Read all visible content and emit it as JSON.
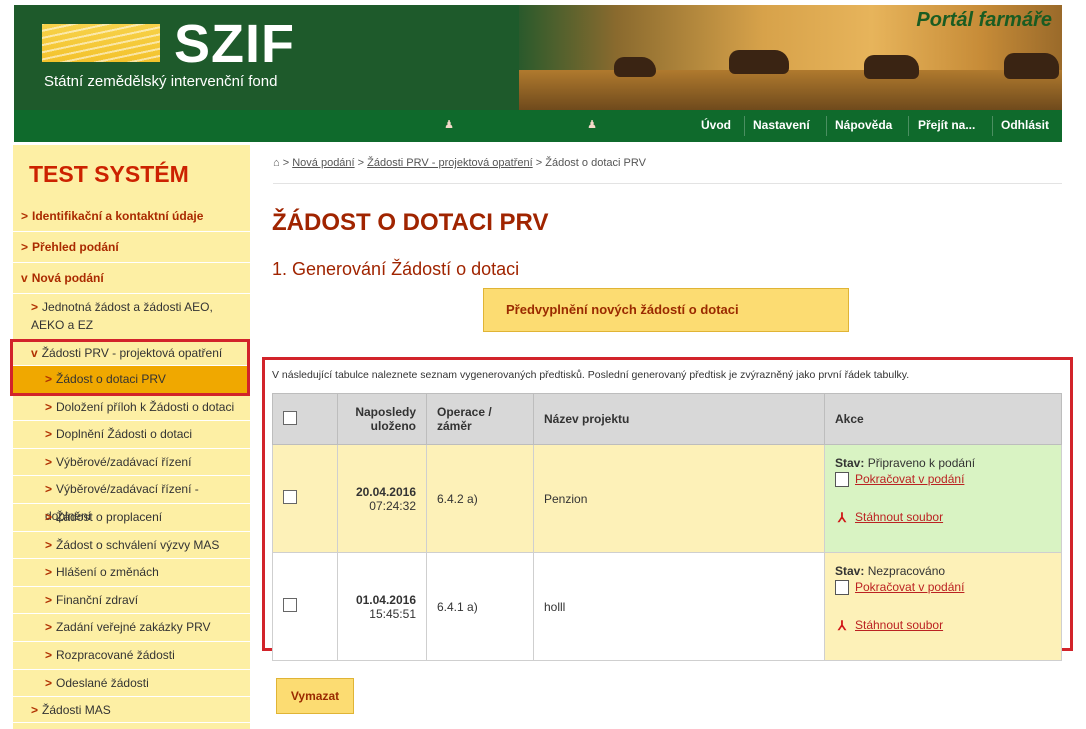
{
  "header": {
    "brand": "SZIF",
    "brand_subtitle": "Státní zemědělský intervenční fond",
    "portal_title": "Portál farmáře",
    "nav": [
      "Úvod",
      "Nastavení",
      "Nápověda",
      "Přejít na...",
      "Odhlásit"
    ]
  },
  "sidebar": {
    "system_title": "TEST SYSTÉM",
    "items": [
      {
        "label": "Identifikační a kontaktní údaje",
        "arrow": ">"
      },
      {
        "label": "Přehled podání",
        "arrow": ">"
      },
      {
        "label": "Nová podání",
        "arrow": "v"
      },
      {
        "label": "Jednotná žádost a žádosti AEO, AEKO a EZ",
        "arrow": ">"
      },
      {
        "label": "Žádosti PRV - projektová opatření",
        "arrow": "v"
      },
      {
        "label": "Žádost o dotaci PRV",
        "arrow": ">"
      },
      {
        "label": "Doložení příloh k Žádosti o dotaci",
        "arrow": ">"
      },
      {
        "label": "Doplnění Žádosti o dotaci",
        "arrow": ">"
      },
      {
        "label": "Výběrové/zadávací řízení",
        "arrow": ">"
      },
      {
        "label": "Výběrové/zadávací řízení - doplnění",
        "arrow": ">"
      },
      {
        "label": "Žádost o proplacení",
        "arrow": ">"
      },
      {
        "label": "Žádost o schválení výzvy MAS",
        "arrow": ">"
      },
      {
        "label": "Hlášení o změnách",
        "arrow": ">"
      },
      {
        "label": "Finanční zdraví",
        "arrow": ">"
      },
      {
        "label": "Zadání veřejné zakázky PRV",
        "arrow": ">"
      },
      {
        "label": "Rozpracované žádosti",
        "arrow": ">"
      },
      {
        "label": "Odeslané žádosti",
        "arrow": ">"
      },
      {
        "label": "Žádosti MAS",
        "arrow": ">"
      }
    ]
  },
  "breadcrumb": {
    "items": [
      "Nová podání",
      "Žádosti PRV - projektová opatření"
    ],
    "current": "Žádost o dotaci PRV",
    "separator": ">"
  },
  "main": {
    "title": "ŽÁDOST O DOTACI PRV",
    "subtitle": "1. Generování Žádostí o dotaci",
    "prefill_button": "Předvyplnění nových žádostí o dotaci",
    "info_text": "V následující tabulce naleznete seznam vygenerovaných předtisků. Poslední generovaný předtisk je zvýrazněný jako první řádek tabulky.",
    "delete_button": "Vymazat"
  },
  "table": {
    "headers": [
      "Naposledy uloženo",
      "Operace / záměr",
      "Název projektu",
      "Akce"
    ],
    "status_label": "Stav:",
    "continue_link": "Pokračovat v podání",
    "download_link": "Stáhnout soubor",
    "rows": [
      {
        "date": "20.04.2016",
        "time": "07:24:32",
        "operation": "6.4.2 a)",
        "project": "Penzion",
        "status": "Připraveno k podání"
      },
      {
        "date": "01.04.2016",
        "time": "15:45:51",
        "operation": "6.4.1 a)",
        "project": "holll",
        "status": "Nezpracováno"
      }
    ]
  },
  "colors": {
    "accent_red": "#d2232a",
    "header_green": "#1e5a2b",
    "sidebar_bg": "#fdefa4",
    "active_item": "#f0a800",
    "title_color": "#a02400"
  }
}
